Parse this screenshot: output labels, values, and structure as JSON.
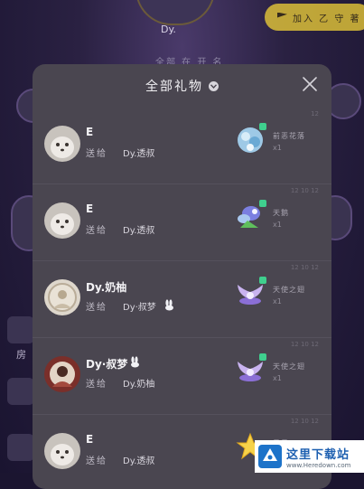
{
  "background": {
    "room_name": "Dy.",
    "room_sub": "全部 在  开 名",
    "join_label": "加入 乙 守 著",
    "side_label": "房"
  },
  "modal": {
    "title": "全部礼物",
    "rows": [
      {
        "sender": "E",
        "send_to": "送给",
        "receiver": "Dy.透叔",
        "gift_name": "前恶花落",
        "gift_count": "x1",
        "time": "12"
      },
      {
        "sender": "E",
        "send_to": "送给",
        "receiver": "Dy.透叔",
        "gift_name": "天鹅",
        "gift_count": "x1",
        "time": "12 10 12"
      },
      {
        "sender": "Dy.奶柚",
        "send_to": "送给",
        "receiver": "Dy·叔梦",
        "gift_name": "天使之翅",
        "gift_count": "x1",
        "time": "12 10 12"
      },
      {
        "sender": "Dy·叔梦",
        "send_to": "送给",
        "receiver": "Dy.奶柚",
        "gift_name": "天使之翅",
        "gift_count": "x1",
        "time": "12 10 12"
      },
      {
        "sender": "E",
        "send_to": "送给",
        "receiver": "Dy.透叔",
        "gift_name": "星星",
        "gift_count": "",
        "time": "12 10 12"
      }
    ]
  },
  "watermark": {
    "title": "这里下载站",
    "url": "www.Heredown.com"
  },
  "colors": {
    "modal_bg": "#4a4650",
    "badge_green": "#3fcf8e",
    "join_yellow": "#f2d337"
  },
  "icons": [
    "dropdown-icon",
    "close-icon",
    "rabbit-icon",
    "gift-icon",
    "star-icon",
    "logo-icon"
  ]
}
